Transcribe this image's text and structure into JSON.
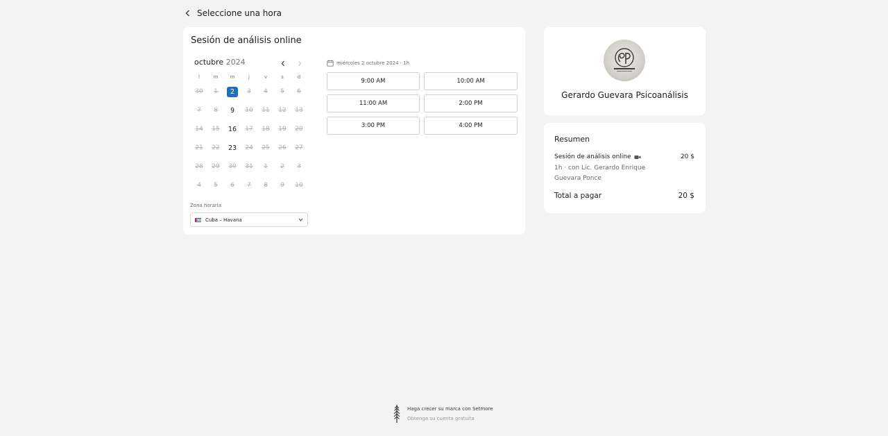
{
  "header": {
    "title": "Seleccione una hora"
  },
  "service": {
    "title": "Sesión de análisis online"
  },
  "calendar": {
    "month": "octubre",
    "year": "2024",
    "weekdays": [
      "l",
      "m",
      "m",
      "j",
      "v",
      "s",
      "d"
    ],
    "days": [
      {
        "d": "30",
        "s": "disabled"
      },
      {
        "d": "1",
        "s": "disabled"
      },
      {
        "d": "2",
        "s": "selected"
      },
      {
        "d": "3",
        "s": "disabled"
      },
      {
        "d": "4",
        "s": "disabled"
      },
      {
        "d": "5",
        "s": "disabled"
      },
      {
        "d": "6",
        "s": "disabled"
      },
      {
        "d": "7",
        "s": "disabled"
      },
      {
        "d": "8",
        "s": "disabled"
      },
      {
        "d": "9",
        "s": "available"
      },
      {
        "d": "10",
        "s": "disabled"
      },
      {
        "d": "11",
        "s": "disabled"
      },
      {
        "d": "12",
        "s": "disabled"
      },
      {
        "d": "13",
        "s": "disabled"
      },
      {
        "d": "14",
        "s": "disabled"
      },
      {
        "d": "15",
        "s": "disabled"
      },
      {
        "d": "16",
        "s": "available"
      },
      {
        "d": "17",
        "s": "disabled"
      },
      {
        "d": "18",
        "s": "disabled"
      },
      {
        "d": "19",
        "s": "disabled"
      },
      {
        "d": "20",
        "s": "disabled"
      },
      {
        "d": "21",
        "s": "disabled"
      },
      {
        "d": "22",
        "s": "disabled"
      },
      {
        "d": "23",
        "s": "available"
      },
      {
        "d": "24",
        "s": "disabled"
      },
      {
        "d": "25",
        "s": "disabled"
      },
      {
        "d": "26",
        "s": "disabled"
      },
      {
        "d": "27",
        "s": "disabled"
      },
      {
        "d": "28",
        "s": "disabled"
      },
      {
        "d": "29",
        "s": "disabled"
      },
      {
        "d": "30",
        "s": "disabled"
      },
      {
        "d": "31",
        "s": "disabled"
      },
      {
        "d": "1",
        "s": "disabled"
      },
      {
        "d": "2",
        "s": "disabled"
      },
      {
        "d": "3",
        "s": "disabled"
      },
      {
        "d": "4",
        "s": "disabled"
      },
      {
        "d": "5",
        "s": "disabled"
      },
      {
        "d": "6",
        "s": "disabled"
      },
      {
        "d": "7",
        "s": "disabled"
      },
      {
        "d": "8",
        "s": "disabled"
      },
      {
        "d": "9",
        "s": "disabled"
      },
      {
        "d": "10",
        "s": "disabled"
      }
    ],
    "selected_color": "#1d6fc4"
  },
  "timezone": {
    "label": "Zona horaria",
    "value": "Cuba – Havana"
  },
  "slots": {
    "date_label": "miércoles 2 octubre 2024 · 1h",
    "times": [
      "9:00 AM",
      "10:00 AM",
      "11:00 AM",
      "2:00 PM",
      "3:00 PM",
      "4:00 PM"
    ]
  },
  "provider": {
    "name": "Gerardo Guevara Psicoanálisis"
  },
  "summary": {
    "title": "Resumen",
    "service": "Sesión de análisis online",
    "price": "20 $",
    "detail": "1h · con Lic. Gerardo Enrique Guevara Ponce",
    "total_label": "Total a pagar",
    "total": "20 $"
  },
  "footer": {
    "line1": "Haga crecer su marca con Setmore",
    "line2": "Obtenga su cuenta gratuita"
  }
}
